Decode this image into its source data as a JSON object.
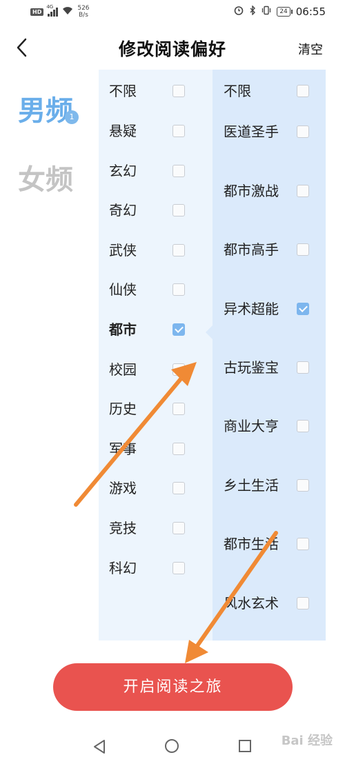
{
  "status_bar": {
    "hd_badge": "HD",
    "net_type": "4G",
    "speed_value": "526",
    "speed_unit": "B/s",
    "battery": "24",
    "time": "06:55"
  },
  "header": {
    "title": "修改阅读偏好",
    "clear_label": "清空"
  },
  "tabs": [
    {
      "label": "男频",
      "selected": true,
      "badge": "1"
    },
    {
      "label": "女频",
      "selected": false
    }
  ],
  "left_column": [
    {
      "label": "不限",
      "checked": false
    },
    {
      "label": "悬疑",
      "checked": false
    },
    {
      "label": "玄幻",
      "checked": false
    },
    {
      "label": "奇幻",
      "checked": false
    },
    {
      "label": "武侠",
      "checked": false
    },
    {
      "label": "仙侠",
      "checked": false
    },
    {
      "label": "都市",
      "checked": true,
      "active": true
    },
    {
      "label": "校园",
      "checked": false
    },
    {
      "label": "历史",
      "checked": false
    },
    {
      "label": "军事",
      "checked": false
    },
    {
      "label": "游戏",
      "checked": false
    },
    {
      "label": "竞技",
      "checked": false
    },
    {
      "label": "科幻",
      "checked": false
    }
  ],
  "right_column": [
    {
      "label": "不限",
      "checked": false
    },
    {
      "label": "医道圣手",
      "checked": false
    },
    {
      "label": "都市激战",
      "checked": false
    },
    {
      "label": "都市高手",
      "checked": false
    },
    {
      "label": "异术超能",
      "checked": true
    },
    {
      "label": "古玩鉴宝",
      "checked": false
    },
    {
      "label": "商业大亨",
      "checked": false
    },
    {
      "label": "乡土生活",
      "checked": false
    },
    {
      "label": "都市生活",
      "checked": false
    },
    {
      "label": "风水玄术",
      "checked": false
    }
  ],
  "cta": {
    "label": "开启阅读之旅"
  },
  "watermark": "Bai 经验",
  "colors": {
    "accent_blue": "#6aaeea",
    "checkbox_checked": "#7db6ee",
    "cta_red": "#e9534f",
    "annotation_orange": "#f08a35",
    "panel_left": "#edf5fd",
    "panel_right": "#dbeafb"
  }
}
